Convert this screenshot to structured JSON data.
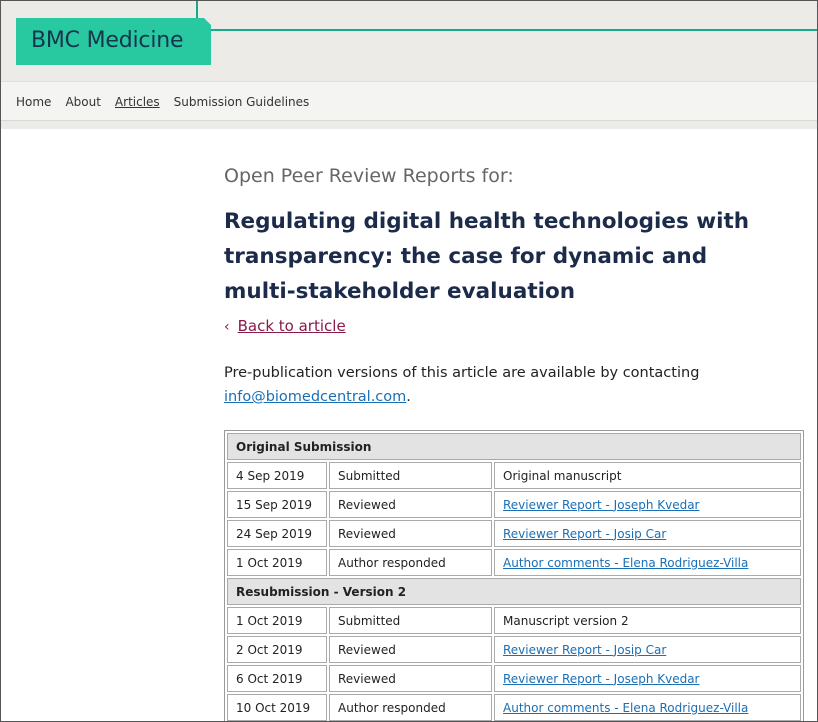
{
  "brand": {
    "logo_text": "BMC Medicine",
    "accent": "#28c8a0",
    "logo_text_color": "#14364d"
  },
  "nav": {
    "items": [
      {
        "label": "Home",
        "active": false
      },
      {
        "label": "About",
        "active": false
      },
      {
        "label": "Articles",
        "active": true
      },
      {
        "label": "Submission Guidelines",
        "active": false
      }
    ]
  },
  "page": {
    "pre_heading": "Open Peer Review Reports for:",
    "title": "Regulating digital health technologies with transparency: the case for dynamic and multi-stakeholder evaluation",
    "back_link": "Back to article",
    "note_text": "Pre-publication versions of this article are available by contacting",
    "note_email": "info@biomedcentral.com",
    "note_end": "."
  },
  "history": {
    "sections": [
      {
        "heading": "Original Submission",
        "rows": [
          {
            "date": "4 Sep 2019",
            "status": "Submitted",
            "detail": "Original manuscript",
            "link": false
          },
          {
            "date": "15 Sep 2019",
            "status": "Reviewed",
            "detail": "Reviewer Report - Joseph Kvedar",
            "link": true
          },
          {
            "date": "24 Sep 2019",
            "status": "Reviewed",
            "detail": "Reviewer Report - Josip Car",
            "link": true
          },
          {
            "date": "1 Oct 2019",
            "status": "Author responded",
            "detail": "Author comments - Elena Rodriguez-Villa",
            "link": true
          }
        ]
      },
      {
        "heading": "Resubmission - Version 2",
        "rows": [
          {
            "date": "1 Oct 2019",
            "status": "Submitted",
            "detail": "Manuscript version 2",
            "link": false
          },
          {
            "date": "2 Oct 2019",
            "status": "Reviewed",
            "detail": "Reviewer Report - Josip Car",
            "link": true
          },
          {
            "date": "6 Oct 2019",
            "status": "Reviewed",
            "detail": "Reviewer Report - Joseph Kvedar",
            "link": true
          },
          {
            "date": "10 Oct 2019",
            "status": "Author responded",
            "detail": "Author comments - Elena Rodriguez-Villa",
            "link": true
          }
        ]
      }
    ]
  }
}
